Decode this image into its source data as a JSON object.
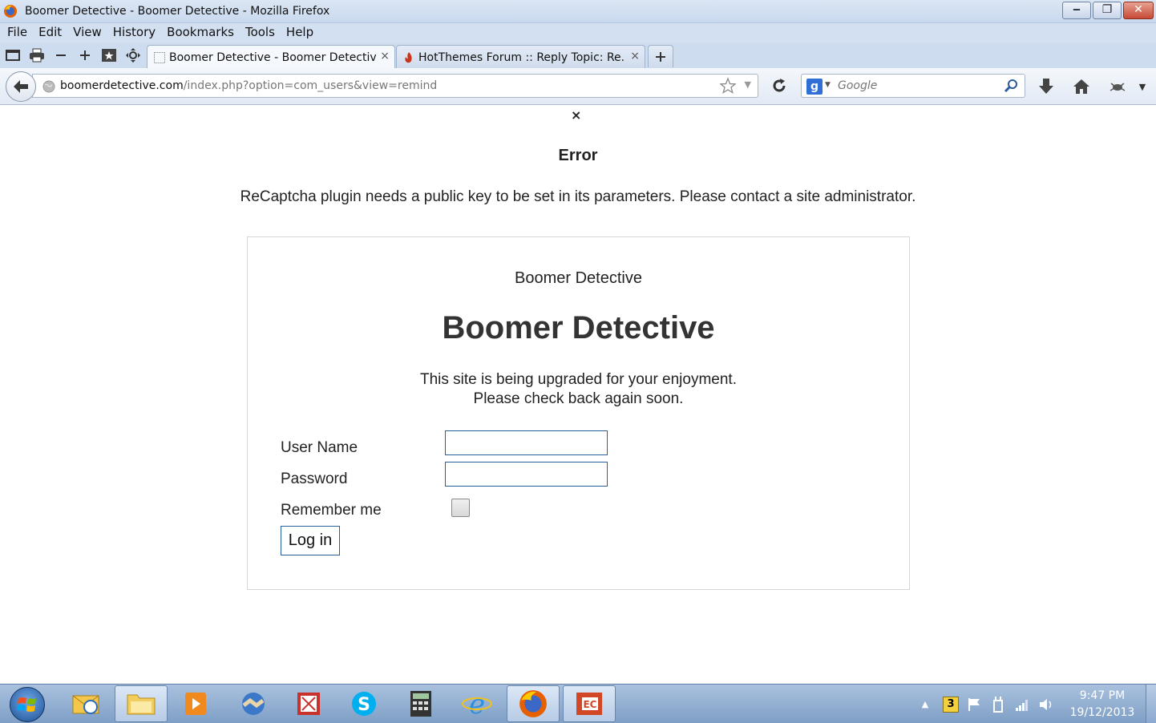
{
  "window": {
    "title": "Boomer Detective - Boomer Detective - Mozilla Firefox"
  },
  "menubar": {
    "items": [
      "File",
      "Edit",
      "View",
      "History",
      "Bookmarks",
      "Tools",
      "Help"
    ]
  },
  "tabs": [
    {
      "label": "Boomer Detective - Boomer Detective",
      "close": "×"
    },
    {
      "label": "HotThemes Forum :: Reply Topic: Re...",
      "close": "×"
    }
  ],
  "navbar": {
    "url_host": "boomerdetective.com",
    "url_path": "/index.php?option=com_users&view=remind",
    "search_placeholder": "Google"
  },
  "page": {
    "close_glyph": "×",
    "error_title": "Error",
    "error_message": "ReCaptcha plugin needs a public key to be set in its parameters. Please contact a site administrator.",
    "site_name_small": "Boomer Detective",
    "site_name_big": "Boomer Detective",
    "offline_line1": "This site is being upgraded for your enjoyment.",
    "offline_line2": "Please check back again soon.",
    "username_label": "User Name",
    "password_label": "Password",
    "remember_label": "Remember me",
    "login_button": "Log in"
  },
  "taskbar": {
    "tray_badge": "3",
    "clock_time": "9:47 PM",
    "clock_date": "19/12/2013"
  },
  "colors": {
    "accent_border": "#2a5f9e",
    "error_text": "#222222"
  }
}
